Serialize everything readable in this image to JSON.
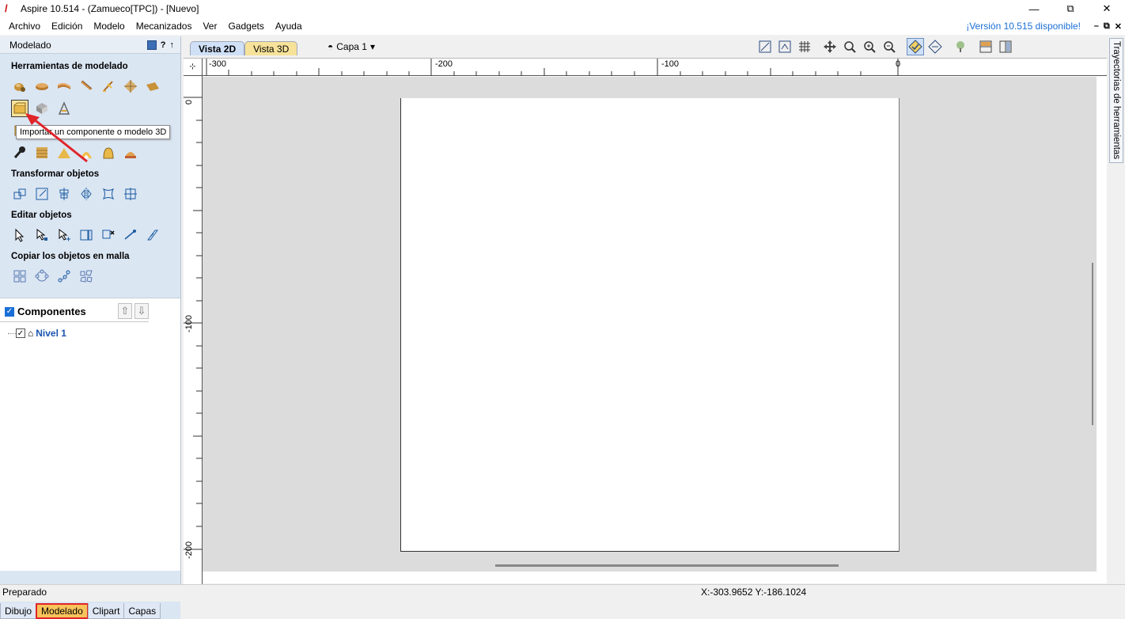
{
  "window": {
    "title": "Aspire 10.514 - (Zamueco[TPC]) - [Nuevo]",
    "minimize": "—",
    "restore": "⧉",
    "close": "✕"
  },
  "menubar": {
    "items": [
      "Archivo",
      "Edición",
      "Modelo",
      "Mecanizados",
      "Ver",
      "Gadgets",
      "Ayuda"
    ],
    "version_link": "¡Versión 10.515 disponible!",
    "mdi_min": "–",
    "mdi_restore": "⧉",
    "mdi_close": "✕"
  },
  "left_panel": {
    "header": "Modelado",
    "help": "?",
    "pin": "↑",
    "sections": {
      "modeling_tools": "Herramientas de modelado",
      "transform": "Transformar objetos",
      "edit": "Editar objetos",
      "copy_grid": "Copiar los objetos en malla"
    },
    "tooltip": "Importar un componente o modelo 3D",
    "components": {
      "title": "Componentes",
      "up": "⇧",
      "down": "⇩",
      "level": "Nivel 1"
    },
    "bottom_tabs": [
      "Dibujo",
      "Modelado",
      "Clipart",
      "Capas"
    ],
    "active_tab": "Modelado"
  },
  "view": {
    "tab_2d": "Vista 2D",
    "tab_3d": "Vista 3D",
    "layer": "Capa 1"
  },
  "rulers": {
    "h_ticks": [
      "-300",
      "-200",
      "-100",
      "0"
    ],
    "v_ticks": [
      "0",
      "-100",
      "-200"
    ]
  },
  "right_panel": {
    "tab": "Trayectorias de herramientas"
  },
  "status": {
    "left": "Preparado",
    "coords": "X:-303.9652 Y:-186.1024"
  },
  "colors": {
    "accent": "#1a6fd6",
    "highlight_red": "#e0242a",
    "tab_gold": "#f7c35a",
    "panel_blue": "#dbe6f3"
  }
}
